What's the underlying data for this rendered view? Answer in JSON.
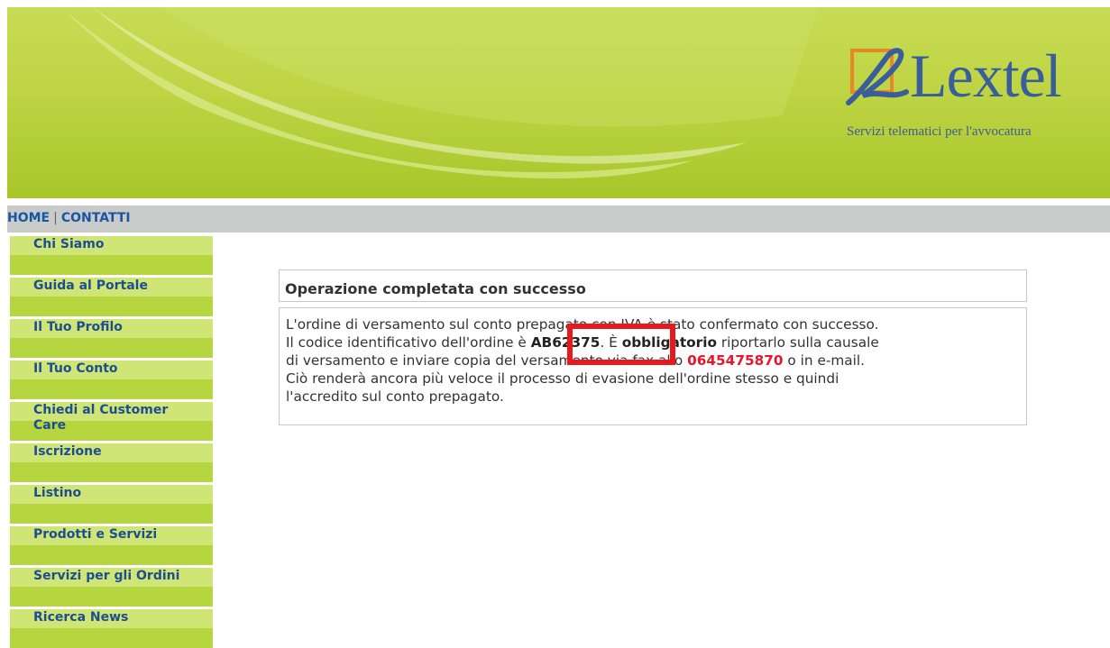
{
  "logo": {
    "name": "Lextel",
    "tagline": "Servizi telematici per l'avvocatura"
  },
  "topnav": {
    "home": "HOME",
    "separator": "|",
    "contatti": "CONTATTI"
  },
  "sidebar": {
    "items": [
      {
        "label": "Chi Siamo"
      },
      {
        "label": "Guida al Portale"
      },
      {
        "label": "Il Tuo Profilo"
      },
      {
        "label": "Il Tuo Conto"
      },
      {
        "label": "Chiedi al Customer Care"
      },
      {
        "label": "Iscrizione"
      },
      {
        "label": "Listino"
      },
      {
        "label": "Prodotti e Servizi"
      },
      {
        "label": "Servizi per gli Ordini"
      },
      {
        "label": "Ricerca News"
      }
    ]
  },
  "message": {
    "title": "Operazione completata con successo",
    "line1": "L'ordine di versamento sul conto prepagato con IVA è stato confermato con successo.",
    "line2_pre": "Il codice identificativo dell'ordine è ",
    "order_code": "AB62375",
    "line2_dot": ". È ",
    "obligatory": "obbligatorio",
    "line2_post": " riportarlo sulla causale",
    "line3_pre": "di versamento e inviare copia del versamento via fax allo ",
    "fax_number": "0645475870",
    "line3_post": " o in e-mail.",
    "line4": "Ciò renderà ancora più veloce il processo di evasione dell'ordine stesso e quindi",
    "line5": "l'accredito sul conto prepagato."
  },
  "colors": {
    "banner_green": "#bed443",
    "sidebar_green": "#b6d63f",
    "nav_blue": "#1a55a0",
    "highlight_red": "#e8181c",
    "fax_red": "#e8162a"
  }
}
